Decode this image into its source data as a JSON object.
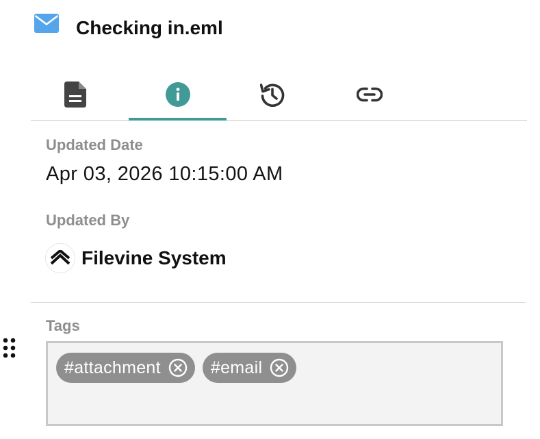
{
  "header": {
    "title": "Checking in.eml",
    "icon": "mail-icon",
    "icon_color": "#55a5ec"
  },
  "tabs": [
    {
      "icon": "document-icon",
      "active": false
    },
    {
      "icon": "info-icon",
      "active": true
    },
    {
      "icon": "history-icon",
      "active": false
    },
    {
      "icon": "link-icon",
      "active": false
    }
  ],
  "accent_color": "#3f9a98",
  "details": {
    "updated_date_label": "Updated Date",
    "updated_date_value": "Apr 03, 2026 10:15:00 AM",
    "updated_by_label": "Updated By",
    "updated_by_value": "Filevine System",
    "avatar_icon": "filevine-chevron-logo"
  },
  "tags": {
    "label": "Tags",
    "items": [
      "#attachment",
      "#email"
    ],
    "remove_icon": "circle-x-icon",
    "chip_color": "#8f8f8f"
  }
}
